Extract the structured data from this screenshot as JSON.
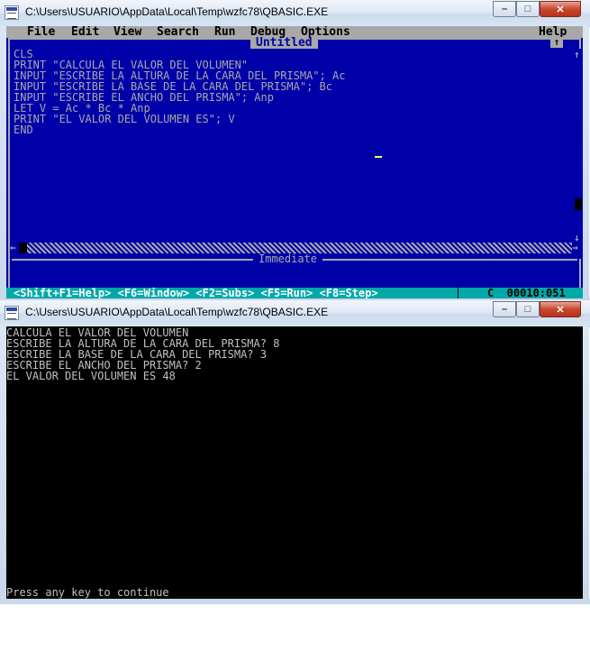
{
  "window1": {
    "title": "C:\\Users\\USUARIO\\AppData\\Local\\Temp\\wzfc78\\QBASIC.EXE",
    "controls": {
      "minimize": "–",
      "maximize": "□",
      "close": "✕"
    }
  },
  "qbasic": {
    "menu": [
      "File",
      "Edit",
      "View",
      "Search",
      "Run",
      "Debug",
      "Options"
    ],
    "help": "Help",
    "doc_title": "Untitled",
    "code": [
      "CLS",
      "PRINT \"CALCULA EL VALOR DEL VOLUMEN\"",
      "INPUT \"ESCRIBE LA ALTURA DE LA CARA DEL PRISMA\"; Ac",
      "INPUT \"ESCRIBE LA BASE DE LA CARA DEL PRISMA\"; Bc",
      "INPUT \"ESCRIBE EL ANCHO DEL PRISMA\"; Anp",
      "LET V = Ac * Bc * Anp",
      "PRINT \"EL VALOR DEL VOLUMEN ES\"; V",
      "END"
    ],
    "immediate_label": "Immediate",
    "status": "<Shift+F1=Help> <F6=Window> <F2=Subs> <F5=Run> <F8=Step>",
    "status_sep": "│",
    "status_pos": "C  00010:051",
    "colors": {
      "background": "#0000a8",
      "menubar": "#a8a8a8",
      "status": "#00a8a8"
    }
  },
  "window2": {
    "title": "C:\\Users\\USUARIO\\AppData\\Local\\Temp\\wzfc78\\QBASIC.EXE",
    "controls": {
      "minimize": "–",
      "maximize": "□",
      "close": "✕"
    }
  },
  "output": {
    "lines": [
      "CALCULA EL VALOR DEL VOLUMEN",
      "ESCRIBE LA ALTURA DE LA CARA DEL PRISMA? 8",
      "ESCRIBE LA BASE DE LA CARA DEL PRISMA? 3",
      "ESCRIBE EL ANCHO DEL PRISMA? 2",
      "EL VALOR DEL VOLUMEN ES 48"
    ],
    "prompt": "Press any key to continue"
  }
}
